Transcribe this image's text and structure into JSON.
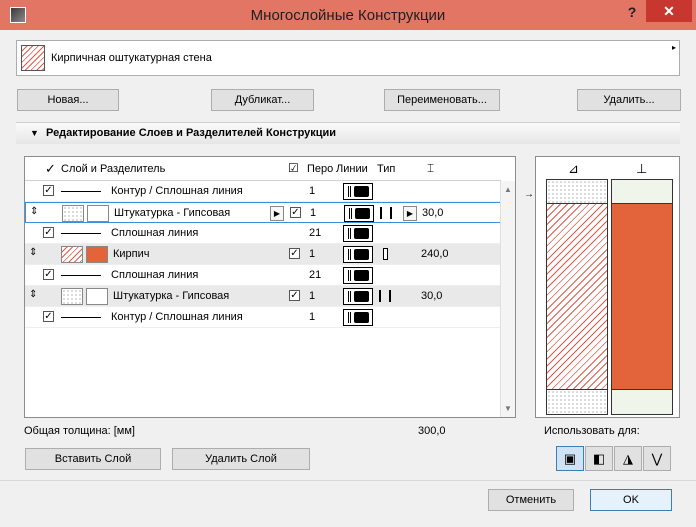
{
  "window": {
    "title": "Многослойные Конструкции",
    "help": "?",
    "close": "✕"
  },
  "preset": {
    "name": "Кирпичная оштукатурная стена",
    "arrow": "▸"
  },
  "buttons": {
    "new": "Новая...",
    "duplicate": "Дубликат...",
    "rename": "Переименовать...",
    "delete": "Удалить..."
  },
  "section": {
    "title": "Редактирование Слоев и Разделителей Конструкции",
    "arrow": "▼"
  },
  "table": {
    "headers": {
      "layer": "Слой и Разделитель",
      "pen": "Перо",
      "lines": "Линии",
      "type": "Тип"
    },
    "rows": [
      {
        "kind": "separator",
        "name": "Контур / Сплошная линия",
        "pen": "1",
        "checked": true
      },
      {
        "kind": "layer",
        "name": "Штукатурка - Гипсовая",
        "pen": "1",
        "thickness": "30,0",
        "checked": true,
        "selected": true
      },
      {
        "kind": "separator",
        "name": "Сплошная линия",
        "pen": "21",
        "checked": true
      },
      {
        "kind": "layer",
        "name": "Кирпич",
        "pen": "1",
        "thickness": "240,0",
        "checked": true
      },
      {
        "kind": "separator",
        "name": "Сплошная линия",
        "pen": "21",
        "checked": true
      },
      {
        "kind": "layer",
        "name": "Штукатурка - Гипсовая",
        "pen": "1",
        "thickness": "30,0",
        "checked": true
      },
      {
        "kind": "separator",
        "name": "Контур / Сплошная линия",
        "pen": "1",
        "checked": true
      }
    ]
  },
  "totals": {
    "label": "Общая толщина: [мм]",
    "value": "300,0"
  },
  "actions": {
    "insert": "Вставить Слой",
    "remove": "Удалить Слой"
  },
  "use_for": {
    "label": "Использовать для:"
  },
  "dialog": {
    "cancel": "Отменить",
    "ok": "OK"
  },
  "colors": {
    "accent": "#3c8dde",
    "titlebar": "#e37565",
    "brick": "#e3643b"
  }
}
